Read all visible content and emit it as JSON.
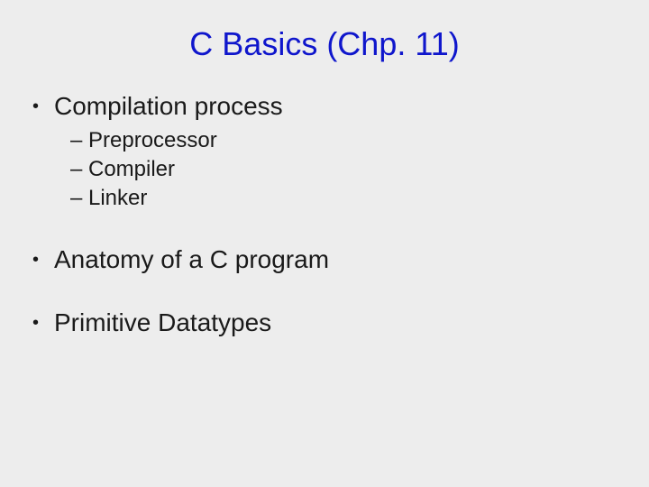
{
  "title": "C Basics (Chp. 11)",
  "bullets": [
    {
      "text": "Compilation process",
      "sub": [
        "Preprocessor",
        "Compiler",
        "Linker"
      ]
    },
    {
      "text": "Anatomy of a C program"
    },
    {
      "text": "Primitive Datatypes"
    }
  ]
}
